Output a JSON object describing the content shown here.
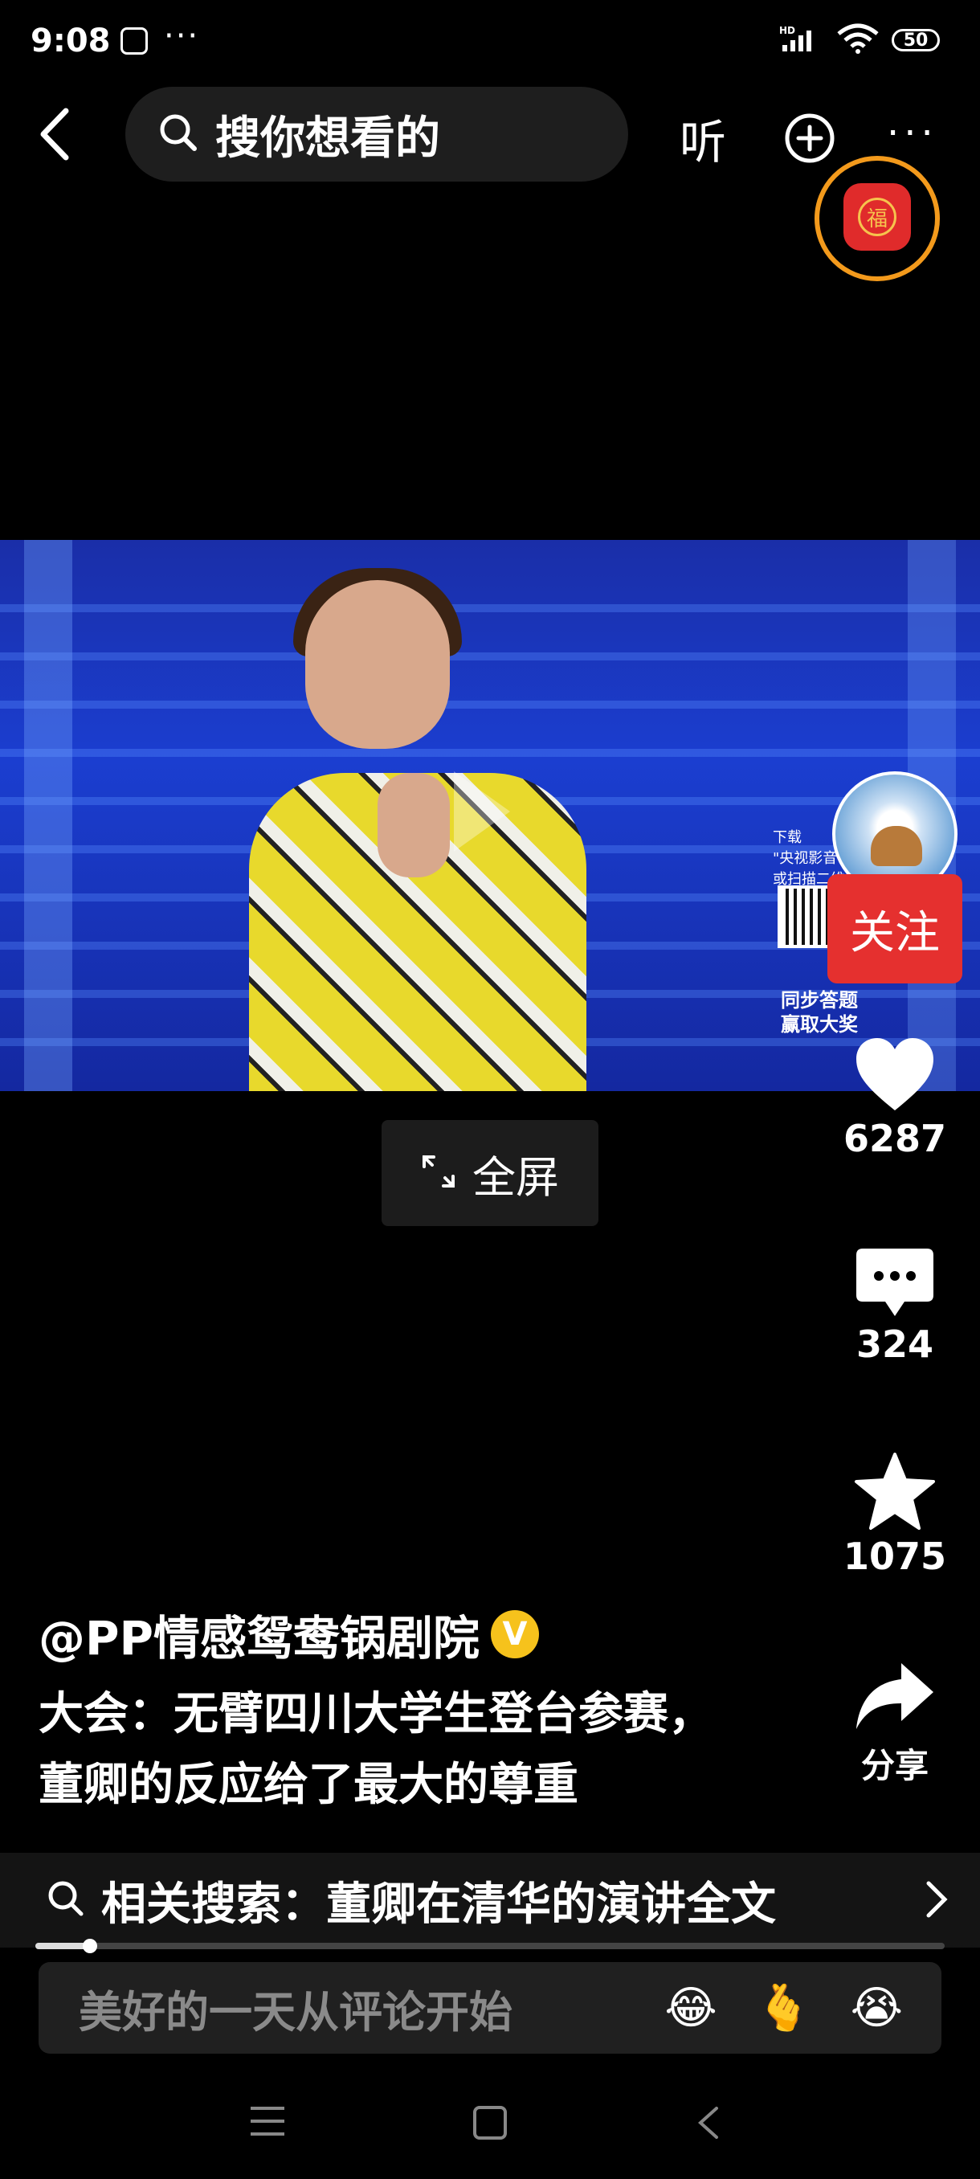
{
  "status_bar": {
    "time": "9:08",
    "more": "···",
    "network": "HD",
    "wifi_sub": "6",
    "battery": "50"
  },
  "top_bar": {
    "search_placeholder": "搜你想看的",
    "listen_label": "听",
    "more_label": "···",
    "fu_badge": "福"
  },
  "video": {
    "side_text": [
      "下载",
      "\"央视影音",
      "或扫描二维"
    ],
    "prize_text": [
      "同步答题",
      "赢取大奖"
    ],
    "fullscreen_label": "全屏"
  },
  "rail": {
    "follow_label": "关注",
    "likes": "6287",
    "comments": "324",
    "favorites": "1075",
    "share_label": "分享"
  },
  "caption": {
    "author": "@PP情感鸳鸯锅剧院",
    "verified": "V",
    "line1": "大会：无臂四川大学生登台参赛，",
    "line2": "董卿的反应给了最大的尊重"
  },
  "related": {
    "text": "相关搜索：董卿在清华的演讲全文"
  },
  "progress": {
    "value": 0.06
  },
  "comment": {
    "placeholder": "美好的一天从评论开始",
    "emojis": [
      "😂",
      "🫰",
      "😭"
    ]
  },
  "colors": {
    "follow": "#e5302f",
    "badge_ring": "#f39a1c",
    "verified": "#f6c21c"
  }
}
